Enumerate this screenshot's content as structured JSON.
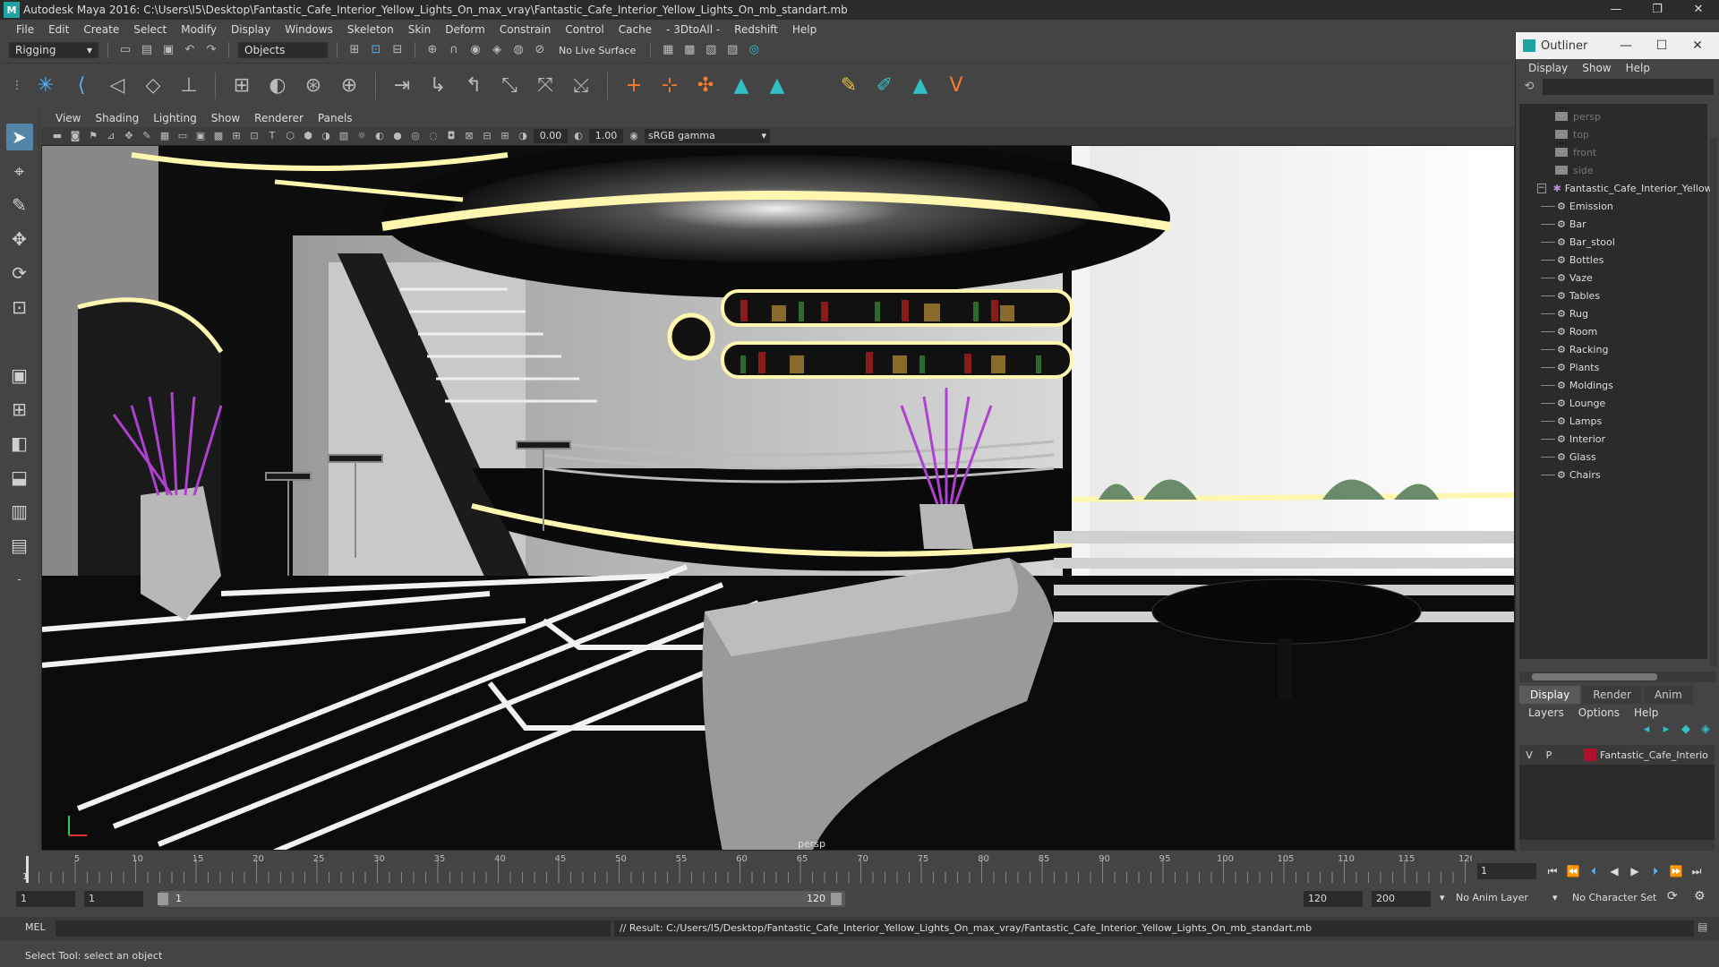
{
  "app": {
    "title": "Autodesk Maya 2016: C:\\Users\\I5\\Desktop\\Fantastic_Cafe_Interior_Yellow_Lights_On_max_vray\\Fantastic_Cafe_Interior_Yellow_Lights_On_mb_standart.mb",
    "window_buttons": [
      "—",
      "❐",
      "✕"
    ]
  },
  "menubar": [
    "File",
    "Edit",
    "Create",
    "Select",
    "Modify",
    "Display",
    "Windows",
    "Skeleton",
    "Skin",
    "Deform",
    "Constrain",
    "Control",
    "Cache",
    "- 3DtoAll -",
    "Redshift",
    "Help"
  ],
  "statusline": {
    "mode": "Rigging",
    "selection_mask": "Objects",
    "live_surface": "No Live Surface"
  },
  "panel": {
    "menu": [
      "View",
      "Shading",
      "Lighting",
      "Show",
      "Renderer",
      "Panels"
    ],
    "exposure": "0.00",
    "gamma": "1.00",
    "color_space": "sRGB gamma",
    "camera_label": "persp"
  },
  "outliner": {
    "title": "Outliner",
    "menu": [
      "Display",
      "Show",
      "Help"
    ],
    "cameras": [
      "persp",
      "top",
      "front",
      "side"
    ],
    "root": "Fantastic_Cafe_Interior_Yellow",
    "children": [
      "Emission",
      "Bar",
      "Bar_stool",
      "Bottles",
      "Vaze",
      "Tables",
      "Rug",
      "Room",
      "Racking",
      "Plants",
      "Moldings",
      "Lounge",
      "Lamps",
      "Interior",
      "Glass",
      "Chairs"
    ]
  },
  "layer_editor": {
    "tabs": [
      "Display",
      "Render",
      "Anim"
    ],
    "active_tab": "Display",
    "menu": [
      "Layers",
      "Options",
      "Help"
    ],
    "layer": {
      "v": "V",
      "p": "P",
      "name": "Fantastic_Cafe_Interio",
      "color": "#b01030"
    }
  },
  "timeline": {
    "ticks": [
      "5",
      "10",
      "15",
      "20",
      "25",
      "30",
      "35",
      "40",
      "45",
      "50",
      "55",
      "60",
      "65",
      "70",
      "75",
      "80",
      "85",
      "90",
      "95",
      "100",
      "105",
      "110",
      "115",
      "120"
    ],
    "start_marker": "1",
    "current_frame": "1"
  },
  "range": {
    "start": "1",
    "playback_start": "1",
    "range_start_label": "1",
    "range_end_label": "120",
    "playback_end": "120",
    "end": "200",
    "anim_layer": "No Anim Layer",
    "character_set": "No Character Set"
  },
  "command": {
    "lang": "MEL",
    "result": "// Result: C:/Users/I5/Desktop/Fantastic_Cafe_Interior_Yellow_Lights_On_max_vray/Fantastic_Cafe_Interior_Yellow_Lights_On_mb_standart.mb"
  },
  "helpline": "Select Tool: select an object",
  "colors": {
    "accent": "#5285a6",
    "maya_teal": "#1fa3a3",
    "glow": "#fff6b0",
    "vase_stems": "#b040d0"
  }
}
